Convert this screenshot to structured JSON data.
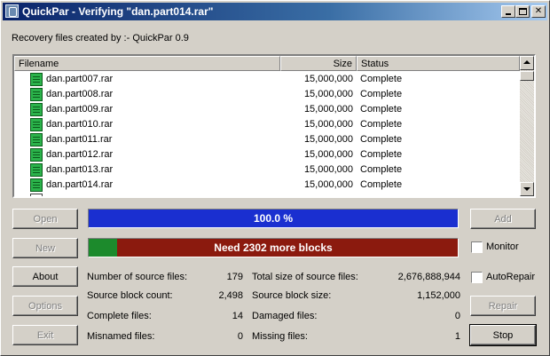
{
  "window": {
    "title": "QuickPar - Verifying \"dan.part014.rar\"",
    "minimize_glyph": "",
    "maximize_glyph": "",
    "close_glyph": "✕"
  },
  "recovery_label": "Recovery files created by :- QuickPar 0.9",
  "list": {
    "columns": {
      "filename": "Filename",
      "size": "Size",
      "status": "Status"
    },
    "rows": [
      {
        "name": "dan.part007.rar",
        "size": "15,000,000",
        "status": "Complete"
      },
      {
        "name": "dan.part008.rar",
        "size": "15,000,000",
        "status": "Complete"
      },
      {
        "name": "dan.part009.rar",
        "size": "15,000,000",
        "status": "Complete"
      },
      {
        "name": "dan.part010.rar",
        "size": "15,000,000",
        "status": "Complete"
      },
      {
        "name": "dan.part011.rar",
        "size": "15,000,000",
        "status": "Complete"
      },
      {
        "name": "dan.part012.rar",
        "size": "15,000,000",
        "status": "Complete"
      },
      {
        "name": "dan.part013.rar",
        "size": "15,000,000",
        "status": "Complete"
      },
      {
        "name": "dan.part014.rar",
        "size": "15,000,000",
        "status": "Complete"
      }
    ]
  },
  "buttons": {
    "open": "Open",
    "new": "New",
    "about": "About",
    "options": "Options",
    "exit": "Exit",
    "add": "Add",
    "repair": "Repair",
    "stop": "Stop"
  },
  "progress": {
    "verify": {
      "label": "100.0 %",
      "fraction": 1.0,
      "color": "#1a2fd0"
    },
    "blocks": {
      "label": "Need 2302 more blocks",
      "fraction": 0.078,
      "done_color": "#1c8a2c",
      "needed_color": "#8b1a0e"
    }
  },
  "checkboxes": {
    "monitor": "Monitor",
    "autorepair": "AutoRepair"
  },
  "stats": {
    "source_files_label": "Number of source files:",
    "source_files_value": "179",
    "total_size_label": "Total size of source files:",
    "total_size_value": "2,676,888,944",
    "block_count_label": "Source block count:",
    "block_count_value": "2,498",
    "block_size_label": "Source block size:",
    "block_size_value": "1,152,000",
    "complete_label": "Complete files:",
    "complete_value": "14",
    "damaged_label": "Damaged files:",
    "damaged_value": "0",
    "misnamed_label": "Misnamed files:",
    "misnamed_value": "0",
    "missing_label": "Missing files:",
    "missing_value": "1"
  }
}
